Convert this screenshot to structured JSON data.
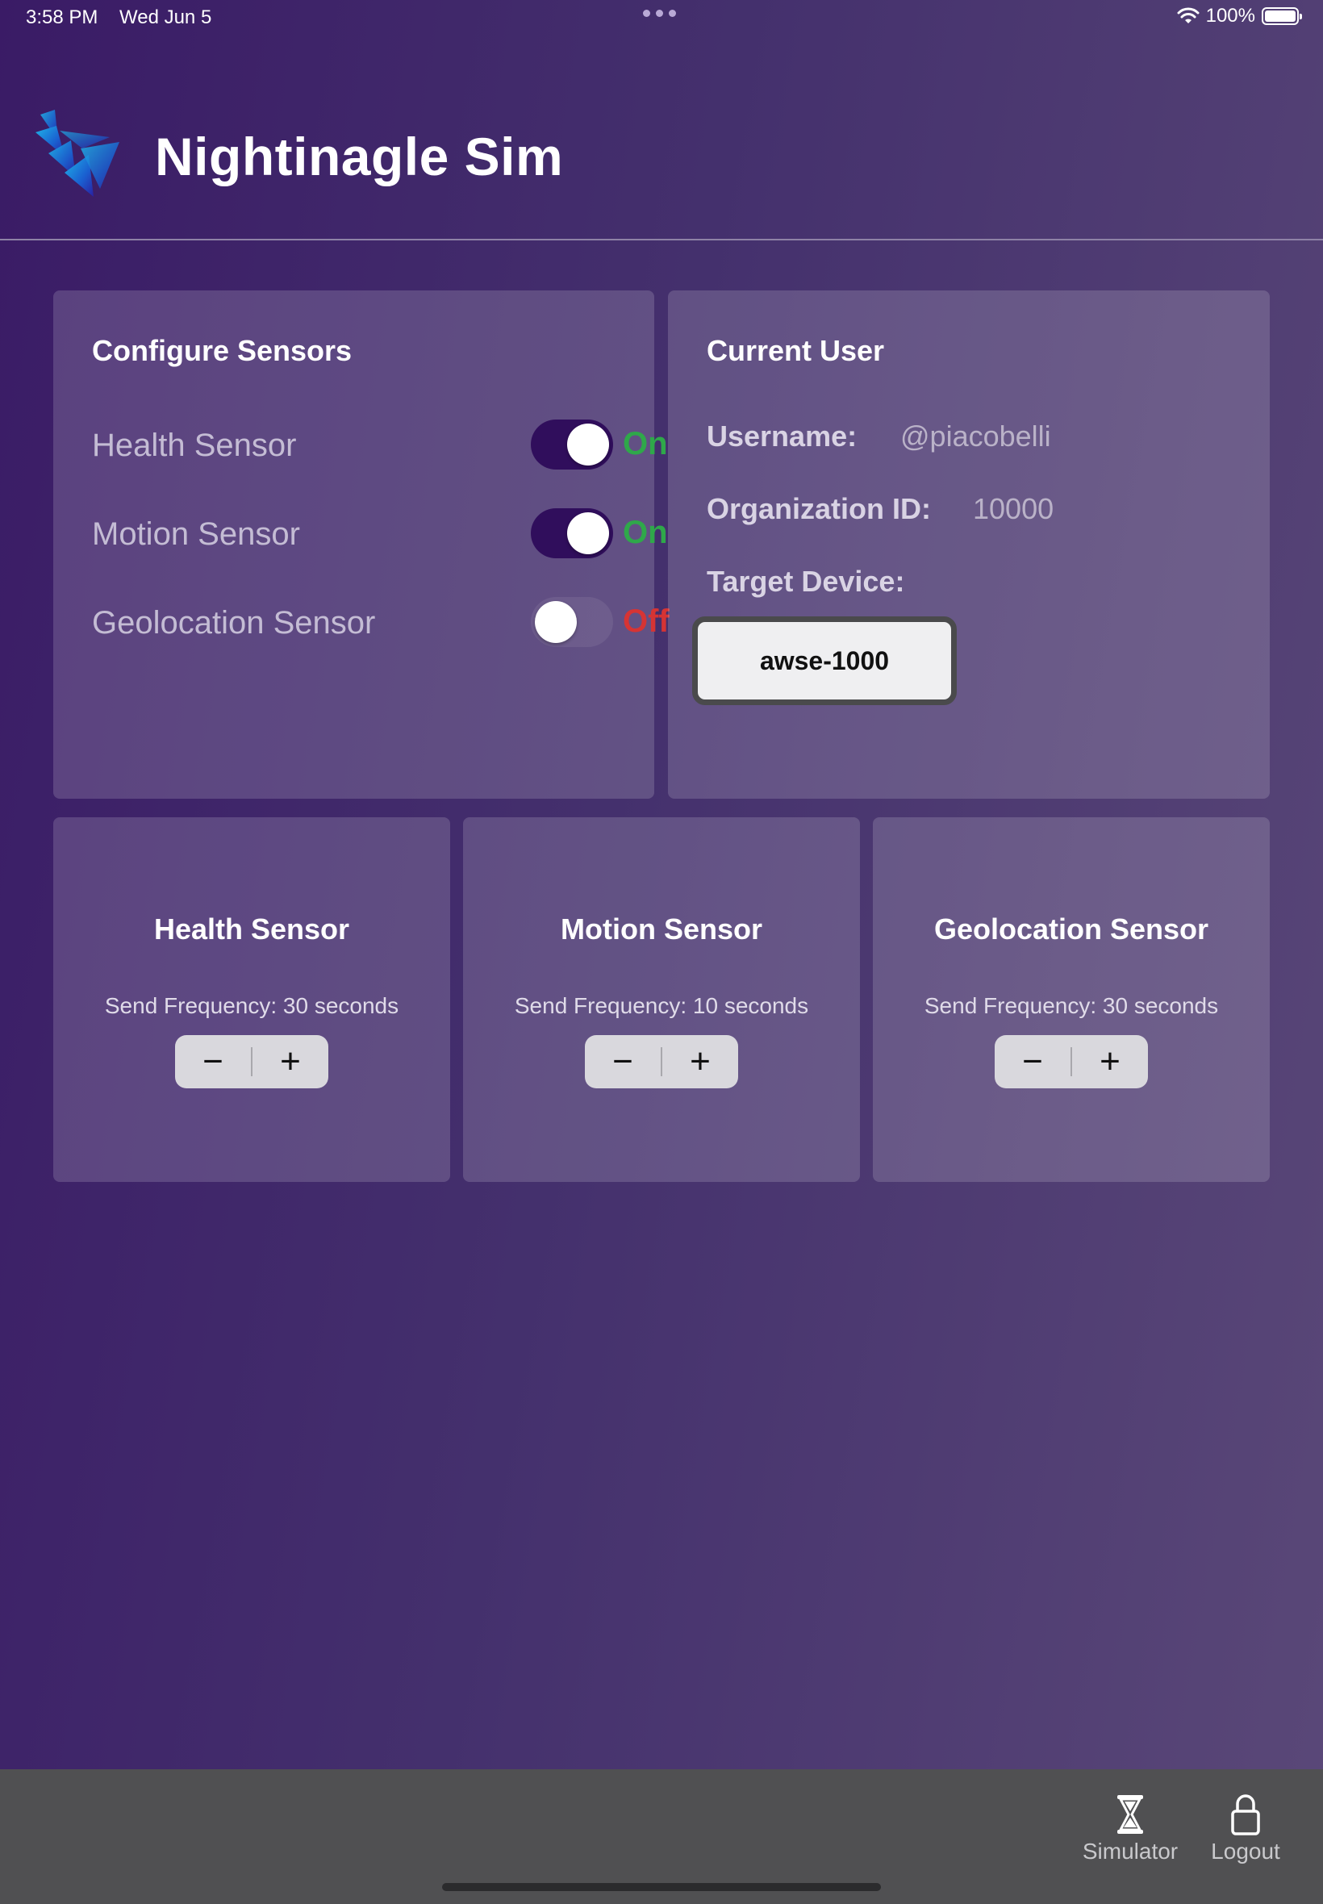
{
  "status_bar": {
    "time": "3:58 PM",
    "date": "Wed Jun 5",
    "battery": "100%"
  },
  "app": {
    "title": "Nightinagle Sim"
  },
  "configure": {
    "title": "Configure Sensors",
    "sensors": [
      {
        "label": "Health Sensor",
        "enabled": true,
        "state": "On"
      },
      {
        "label": "Motion Sensor",
        "enabled": true,
        "state": "On"
      },
      {
        "label": "Geolocation Sensor",
        "enabled": false,
        "state": "Off"
      }
    ]
  },
  "user": {
    "title": "Current User",
    "username_label": "Username:",
    "username": "@piacobelli",
    "org_label": "Organization ID:",
    "org_id": "10000",
    "device_label": "Target Device:",
    "device": "awse-1000"
  },
  "frequency_cards": [
    {
      "name": "Health Sensor",
      "freq": "Send Frequency: 30 seconds"
    },
    {
      "name": "Motion Sensor",
      "freq": "Send Frequency: 10 seconds"
    },
    {
      "name": "Geolocation Sensor",
      "freq": "Send Frequency: 30 seconds"
    }
  ],
  "stepper": {
    "minus": "−",
    "plus": "+"
  },
  "tabbar": {
    "items": [
      {
        "label": "Simulator",
        "icon": "hourglass-icon"
      },
      {
        "label": "Logout",
        "icon": "lock-icon"
      }
    ]
  },
  "colors": {
    "on": "#2fa84a",
    "off": "#d63434",
    "toggle_on": "#300e5c"
  }
}
